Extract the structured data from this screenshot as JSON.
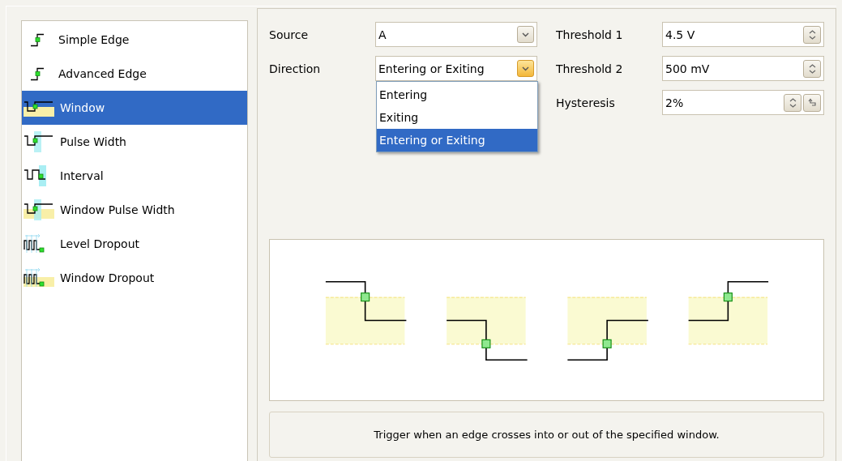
{
  "trigger_types": [
    {
      "label": "Simple Edge",
      "kind": "edge",
      "selected": false
    },
    {
      "label": "Advanced Edge",
      "kind": "edge",
      "selected": false
    },
    {
      "label": "Window",
      "kind": "window",
      "selected": true
    },
    {
      "label": "Pulse Width",
      "kind": "pulse",
      "selected": false
    },
    {
      "label": "Interval",
      "kind": "interval",
      "selected": false
    },
    {
      "label": "Window Pulse Width",
      "kind": "window-pulse",
      "selected": false
    },
    {
      "label": "Level Dropout",
      "kind": "dropout",
      "selected": false
    },
    {
      "label": "Window Dropout",
      "kind": "window-dropout",
      "selected": false
    }
  ],
  "source": {
    "label": "Source",
    "value": "A",
    "expanded": false
  },
  "direction": {
    "label": "Direction",
    "value": "Entering or Exiting",
    "expanded": true,
    "options": [
      {
        "label": "Entering",
        "selected": false
      },
      {
        "label": "Exiting",
        "selected": false
      },
      {
        "label": "Entering or Exiting",
        "selected": true
      }
    ]
  },
  "settings": [
    {
      "label": "Threshold 1",
      "value": "4.5 V",
      "kind": "spin"
    },
    {
      "label": "Threshold 2",
      "value": "500 mV",
      "kind": "spin"
    },
    {
      "label": "Hysteresis",
      "value": "2%",
      "kind": "spin-reset"
    }
  ],
  "description": "Trigger when an edge crosses into or out of the specified window."
}
